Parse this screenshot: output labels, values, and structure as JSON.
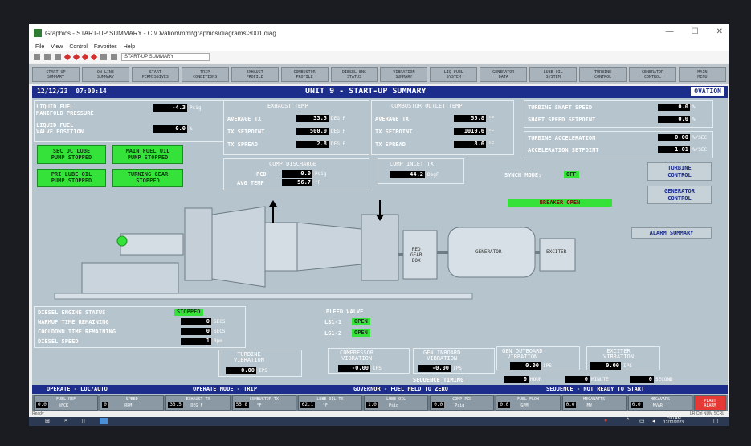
{
  "window": {
    "title": "Graphics - START-UP SUMMARY - C:\\Ovation\\mmi\\graphics\\diagrams\\3001.diag",
    "minimize": "—",
    "maximize": "☐",
    "close": "✕"
  },
  "menu": [
    "File",
    "View",
    "Control",
    "Favorites",
    "Help"
  ],
  "toolbar": {
    "diagram_name": "START-UP SUMMARY"
  },
  "nav_buttons": [
    "START-UP\nSUMMARY",
    "ON-LINE\nSUMMARY",
    "START\nPERMISSIVES",
    "TRIP\nCONDITIONS",
    "EXHAUST\nPROFILE",
    "COMBUSTOR\nPROFILE",
    "DIESEL ENG\nSTATUS",
    "VIBRATION\nSUMMARY",
    "LIQ FUEL\nSYSTEM",
    "GENERATOR\nDATA",
    "LUBE OIL\nSYSTEM",
    "TURBINE\nCONTROL",
    "GENERATOR\nCONTROL",
    "MAIN\nMENU"
  ],
  "header": {
    "date": "12/12/23",
    "time": "07:00:14",
    "title": "UNIT 9 - START-UP SUMMARY",
    "logo": "OVATION"
  },
  "liquid_fuel": {
    "manifold_label": "LIQUID FUEL\nMANIFOLD PRESSURE",
    "manifold_value": "-4.3",
    "manifold_unit": "Psig",
    "valve_label": "LIQUID FUEL\nVALVE POSITION",
    "valve_value": "0.0",
    "valve_unit": "%"
  },
  "pumps": {
    "sec_dc": "SEC DC LUBE\nPUMP STOPPED",
    "main_fuel": "MAIN FUEL OIL\nPUMP STOPPED",
    "pri_lube": "PRI LUBE OIL\nPUMP STOPPED",
    "turning_gear": "TURNING GEAR\nSTOPPED"
  },
  "exhaust": {
    "title": "EXHAUST TEMP",
    "avg_label": "AVERAGE TX",
    "avg_value": "33.5",
    "setpoint_label": "TX SETPOINT",
    "setpoint_value": "500.0",
    "spread_label": "TX SPREAD",
    "spread_value": "2.8",
    "unit": "DEG F"
  },
  "combustor": {
    "title": "COMBUSTOR OUTLET TEMP",
    "avg_label": "AVERAGE TX",
    "avg_value": "55.8",
    "setpoint_label": "TX SETPOINT",
    "setpoint_value": "1010.6",
    "spread_label": "TX SPREAD",
    "spread_value": "8.6",
    "unit": "°F"
  },
  "turbine": {
    "shaft_speed_label": "TURBINE SHAFT SPEED",
    "shaft_speed_value": "0.0",
    "shaft_sp_label": "SHAFT SPEED SETPOINT",
    "shaft_sp_value": "0.0",
    "unit_pct": "%",
    "accel_label": "TURBINE ACCELERATION",
    "accel_value": "0.00",
    "accel_sp_label": "ACCELERATION SETPOINT",
    "accel_sp_value": "1.01",
    "unit_accel": "%/SEC"
  },
  "comp_discharge": {
    "title": "COMP DISCHARGE",
    "pcd_label": "PCD",
    "pcd_value": "0.0",
    "pcd_unit": "Psig",
    "avg_label": "AVG TEMP",
    "avg_value": "56.7",
    "avg_unit": "°F"
  },
  "comp_inlet": {
    "title": "COMP INLET TX",
    "value": "44.2",
    "unit": "DegF"
  },
  "synch": {
    "label": "SYNCH MODE:",
    "value": "OFF"
  },
  "breaker": "BREAKER OPEN",
  "side_buttons": {
    "turbine_control": "TURBINE\nCONTROL",
    "generator_control": "GENERATOR\nCONTROL",
    "alarm_summary": "ALARM SUMMARY"
  },
  "equipment": {
    "red_gear_box": "RED\nGEAR\nBOX",
    "generator": "GENERATOR",
    "exciter": "EXCITER"
  },
  "diesel": {
    "status_label": "DIESEL ENGINE STATUS",
    "status_value": "STOPPED",
    "warmup_label": "WARMUP TIME REMAINING",
    "warmup_value": "0",
    "cooldown_label": "COOLDOWN TIME REMAINING",
    "cooldown_value": "0",
    "unit_secs": "SECS",
    "speed_label": "DIESEL SPEED",
    "speed_value": "1",
    "speed_unit": "Rpm"
  },
  "bleed": {
    "title": "BLEED VALVE",
    "ls1_label": "LS1-1",
    "ls1_value": "OPEN",
    "ls2_label": "LS1-2",
    "ls2_value": "OPEN"
  },
  "vibration": [
    {
      "label": "TURBINE\nVIBRATION",
      "value": "0.00",
      "unit": "IPS"
    },
    {
      "label": "COMPRESSOR\nVIBRATION",
      "value": "-0.00",
      "unit": "IPS"
    },
    {
      "label": "GEN INBOARD\nVIBRATION",
      "value": "-0.00",
      "unit": "IPS"
    },
    {
      "label": "GEN OUTBOARD\nVIBRATION",
      "value": "0.00",
      "unit": "IPS"
    },
    {
      "label": "EXCITER\nVIBRATION",
      "value": "0.00",
      "unit": "IPS"
    }
  ],
  "sequence_timing": {
    "label": "SEQUENCE TIMING",
    "hour": "0",
    "hour_unit": "HOUR",
    "minute": "0",
    "minute_unit": "MINUTE",
    "second": "0",
    "second_unit": "SECOND"
  },
  "bottom_status": {
    "operate": "OPERATE - LOC/AUTO",
    "mode": "OPERATE MODE - TRIP",
    "governor": "GOVERNOR - FUEL HELD TO ZERO",
    "sequence": "SEQUENCE - NOT READY TO START"
  },
  "footer": [
    {
      "label": "FUEL REF",
      "value": "0.0",
      "unit": "%FCK"
    },
    {
      "label": "SPEED",
      "value": "0",
      "unit": "RPM"
    },
    {
      "label": "EXHAUST TX",
      "value": "33.5",
      "unit": "DEG F"
    },
    {
      "label": "COMBUSTOR TX",
      "value": "55.8",
      "unit": "°F"
    },
    {
      "label": "LUBE OIL TX",
      "value": "62.1",
      "unit": "°F"
    },
    {
      "label": "LUBE OIL",
      "value": "1.0",
      "unit": "Psig"
    },
    {
      "label": "COMP PCD",
      "value": "0.0",
      "unit": "Psig"
    },
    {
      "label": "FUEL FLOW",
      "value": "0.0",
      "unit": "GPM"
    },
    {
      "label": "MEGAWATTS",
      "value": "0.0",
      "unit": "MW"
    },
    {
      "label": "MEGAVARS",
      "value": "0.0",
      "unit": "MVAR"
    }
  ],
  "plant_alarm": "PLANT\nALARM",
  "statusbar": {
    "ready": "Ready",
    "right": "LR  Ctrl  NUM  SCRL"
  },
  "taskbar": {
    "time": "7:00 AM",
    "date": "12/12/2023"
  },
  "colors": {
    "header_blue": "#1c2d8c",
    "screen_bg": "#b5c4cd",
    "status_green": "#35e23a",
    "alarm_red": "#e53935"
  }
}
